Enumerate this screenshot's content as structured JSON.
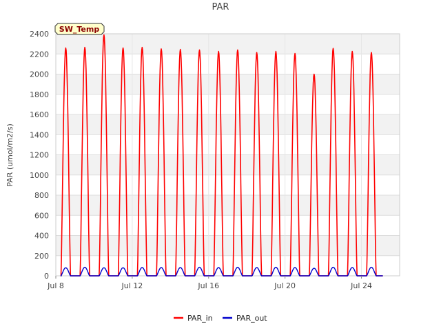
{
  "chart_data": {
    "type": "line",
    "title": "PAR",
    "ylabel": "PAR (umol/m2/s)",
    "xlabel": "",
    "ylim": [
      0,
      2400
    ],
    "yticks": [
      0,
      200,
      400,
      600,
      800,
      1000,
      1200,
      1400,
      1600,
      1800,
      2000,
      2200,
      2400
    ],
    "xlim": [
      "2024-07-08",
      "2024-07-26"
    ],
    "xticks": [
      {
        "date": "2024-07-08",
        "label": "Jul 8"
      },
      {
        "date": "2024-07-12",
        "label": "Jul 12"
      },
      {
        "date": "2024-07-16",
        "label": "Jul 16"
      },
      {
        "date": "2024-07-20",
        "label": "Jul 20"
      },
      {
        "date": "2024-07-24",
        "label": "Jul 24"
      }
    ],
    "grid": true,
    "background_bands": true,
    "legend_position": "bottom",
    "site_label": "SW_Temp",
    "series": [
      {
        "name": "PAR_in",
        "color": "#ff0000",
        "daily_peaks": [
          {
            "date": "2024-07-08",
            "peak": 2260
          },
          {
            "date": "2024-07-09",
            "peak": 2265
          },
          {
            "date": "2024-07-10",
            "peak": 2390
          },
          {
            "date": "2024-07-11",
            "peak": 2260
          },
          {
            "date": "2024-07-12",
            "peak": 2265
          },
          {
            "date": "2024-07-13",
            "peak": 2250
          },
          {
            "date": "2024-07-14",
            "peak": 2245
          },
          {
            "date": "2024-07-15",
            "peak": 2240
          },
          {
            "date": "2024-07-16",
            "peak": 2225
          },
          {
            "date": "2024-07-17",
            "peak": 2240
          },
          {
            "date": "2024-07-18",
            "peak": 2215
          },
          {
            "date": "2024-07-19",
            "peak": 2225
          },
          {
            "date": "2024-07-20",
            "peak": 2205
          },
          {
            "date": "2024-07-21",
            "peak": 2000
          },
          {
            "date": "2024-07-22",
            "peak": 2255
          },
          {
            "date": "2024-07-23",
            "peak": 2225
          },
          {
            "date": "2024-07-24",
            "peak": 2215
          }
        ]
      },
      {
        "name": "PAR_out",
        "color": "#0000cc",
        "daily_peaks": [
          {
            "date": "2024-07-08",
            "peak": 80
          },
          {
            "date": "2024-07-09",
            "peak": 85
          },
          {
            "date": "2024-07-10",
            "peak": 80
          },
          {
            "date": "2024-07-11",
            "peak": 80
          },
          {
            "date": "2024-07-12",
            "peak": 82
          },
          {
            "date": "2024-07-13",
            "peak": 82
          },
          {
            "date": "2024-07-14",
            "peak": 82
          },
          {
            "date": "2024-07-15",
            "peak": 85
          },
          {
            "date": "2024-07-16",
            "peak": 82
          },
          {
            "date": "2024-07-17",
            "peak": 85
          },
          {
            "date": "2024-07-18",
            "peak": 82
          },
          {
            "date": "2024-07-19",
            "peak": 85
          },
          {
            "date": "2024-07-20",
            "peak": 82
          },
          {
            "date": "2024-07-21",
            "peak": 75
          },
          {
            "date": "2024-07-22",
            "peak": 85
          },
          {
            "date": "2024-07-23",
            "peak": 82
          },
          {
            "date": "2024-07-24",
            "peak": 85
          }
        ]
      }
    ]
  }
}
